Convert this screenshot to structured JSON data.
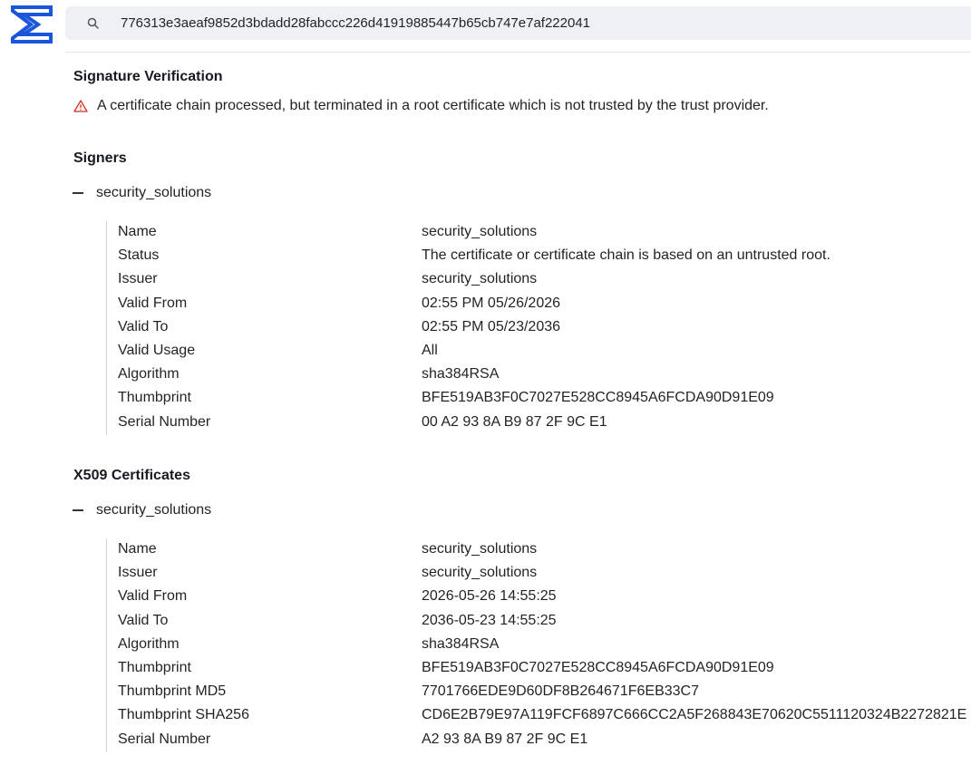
{
  "search": {
    "value": "776313e3aeaf9852d3bdadd28fabccc226d41919885447b65cb747e7af222041"
  },
  "signature": {
    "title": "Signature Verification",
    "warning": "A certificate chain processed, but terminated in a root certificate which is not trusted by the trust provider."
  },
  "signers": {
    "title": "Signers",
    "toggle_label": "security_solutions",
    "rows": [
      {
        "key": "Name",
        "value": "security_solutions"
      },
      {
        "key": "Status",
        "value": "The certificate or certificate chain is based on an untrusted root."
      },
      {
        "key": "Issuer",
        "value": "security_solutions"
      },
      {
        "key": "Valid From",
        "value": "02:55 PM 05/26/2026"
      },
      {
        "key": "Valid To",
        "value": "02:55 PM 05/23/2036"
      },
      {
        "key": "Valid Usage",
        "value": "All"
      },
      {
        "key": "Algorithm",
        "value": "sha384RSA"
      },
      {
        "key": "Thumbprint",
        "value": "BFE519AB3F0C7027E528CC8945A6FCDA90D91E09"
      },
      {
        "key": "Serial Number",
        "value": "00 A2 93 8A B9 87 2F 9C E1"
      }
    ]
  },
  "x509": {
    "title": "X509 Certificates",
    "toggle_label": "security_solutions",
    "rows": [
      {
        "key": "Name",
        "value": "security_solutions"
      },
      {
        "key": "Issuer",
        "value": "security_solutions"
      },
      {
        "key": "Valid From",
        "value": "2026-05-26 14:55:25"
      },
      {
        "key": "Valid To",
        "value": "2036-05-23 14:55:25"
      },
      {
        "key": "Algorithm",
        "value": "sha384RSA"
      },
      {
        "key": "Thumbprint",
        "value": "BFE519AB3F0C7027E528CC8945A6FCDA90D91E09"
      },
      {
        "key": "Thumbprint MD5",
        "value": "7701766EDE9D60DF8B264671F6EB33C7"
      },
      {
        "key": "Thumbprint SHA256",
        "value": "CD6E2B79E97A119FCF6897C666CC2A5F268843E70620C5511120324B2272821E"
      },
      {
        "key": "Serial Number",
        "value": "A2 93 8A B9 87 2F 9C E1"
      }
    ]
  },
  "colors": {
    "logo": "#1a56db",
    "warning": "#d92d20",
    "searchbar_bg": "#eef0f5"
  },
  "icons": {
    "logo": "sigma-logo-icon",
    "search": "search-icon",
    "warning": "warning-triangle-icon",
    "collapse": "dash-collapse-icon"
  }
}
